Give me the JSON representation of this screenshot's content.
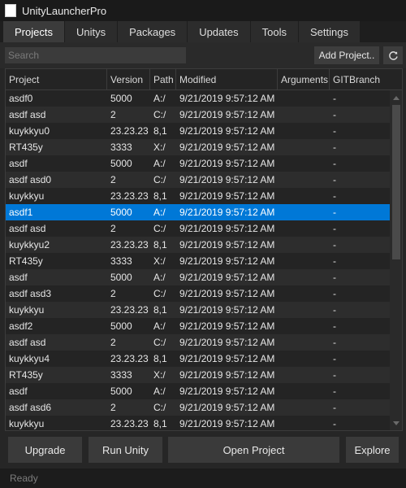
{
  "window": {
    "title": "UnityLauncherPro"
  },
  "tabs": [
    {
      "label": "Projects"
    },
    {
      "label": "Unitys"
    },
    {
      "label": "Packages"
    },
    {
      "label": "Updates"
    },
    {
      "label": "Tools"
    },
    {
      "label": "Settings"
    }
  ],
  "toolbar": {
    "search_placeholder": "Search",
    "add_project_label": "Add Project..",
    "refresh_icon": "refresh-icon"
  },
  "grid": {
    "columns": [
      "Project",
      "Version",
      "Path",
      "Modified",
      "Arguments",
      "GITBranch"
    ],
    "selected_index": 7,
    "rows": [
      [
        "asdf0",
        "5000",
        "A:/",
        "9/21/2019 9:57:12 AM",
        "",
        "-"
      ],
      [
        "asdf asd",
        "2",
        "C:/",
        "9/21/2019 9:57:12 AM",
        "",
        "-"
      ],
      [
        "kuykkyu0",
        "23.23.23",
        "8,1",
        "9/21/2019 9:57:12 AM",
        "",
        "-"
      ],
      [
        "RT435y",
        "3333",
        "X:/",
        "9/21/2019 9:57:12 AM",
        "",
        "-"
      ],
      [
        "asdf",
        "5000",
        "A:/",
        "9/21/2019 9:57:12 AM",
        "",
        "-"
      ],
      [
        "asdf asd0",
        "2",
        "C:/",
        "9/21/2019 9:57:12 AM",
        "",
        "-"
      ],
      [
        "kuykkyu",
        "23.23.23",
        "8,1",
        "9/21/2019 9:57:12 AM",
        "",
        "-"
      ],
      [
        "asdf1",
        "5000",
        "A:/",
        "9/21/2019 9:57:12 AM",
        "",
        "-"
      ],
      [
        "asdf asd",
        "2",
        "C:/",
        "9/21/2019 9:57:12 AM",
        "",
        "-"
      ],
      [
        "kuykkyu2",
        "23.23.23",
        "8,1",
        "9/21/2019 9:57:12 AM",
        "",
        "-"
      ],
      [
        "RT435y",
        "3333",
        "X:/",
        "9/21/2019 9:57:12 AM",
        "",
        "-"
      ],
      [
        "asdf",
        "5000",
        "A:/",
        "9/21/2019 9:57:12 AM",
        "",
        "-"
      ],
      [
        "asdf asd3",
        "2",
        "C:/",
        "9/21/2019 9:57:12 AM",
        "",
        "-"
      ],
      [
        "kuykkyu",
        "23.23.23",
        "8,1",
        "9/21/2019 9:57:12 AM",
        "",
        "-"
      ],
      [
        "asdf2",
        "5000",
        "A:/",
        "9/21/2019 9:57:12 AM",
        "",
        "-"
      ],
      [
        "asdf asd",
        "2",
        "C:/",
        "9/21/2019 9:57:12 AM",
        "",
        "-"
      ],
      [
        "kuykkyu4",
        "23.23.23",
        "8,1",
        "9/21/2019 9:57:12 AM",
        "",
        "-"
      ],
      [
        "RT435y",
        "3333",
        "X:/",
        "9/21/2019 9:57:12 AM",
        "",
        "-"
      ],
      [
        "asdf",
        "5000",
        "A:/",
        "9/21/2019 9:57:12 AM",
        "",
        "-"
      ],
      [
        "asdf asd6",
        "2",
        "C:/",
        "9/21/2019 9:57:12 AM",
        "",
        "-"
      ],
      [
        "kuykkyu",
        "23.23.23",
        "8,1",
        "9/21/2019 9:57:12 AM",
        "",
        "-"
      ]
    ]
  },
  "actions": {
    "upgrade_label": "Upgrade",
    "run_unity_label": "Run Unity",
    "open_project_label": "Open Project",
    "explore_label": "Explore"
  },
  "status": {
    "text": "Ready"
  },
  "colors": {
    "accent": "#0078d7",
    "background": "#262626",
    "row": "#242424",
    "row_alt": "#2d2d2d"
  }
}
